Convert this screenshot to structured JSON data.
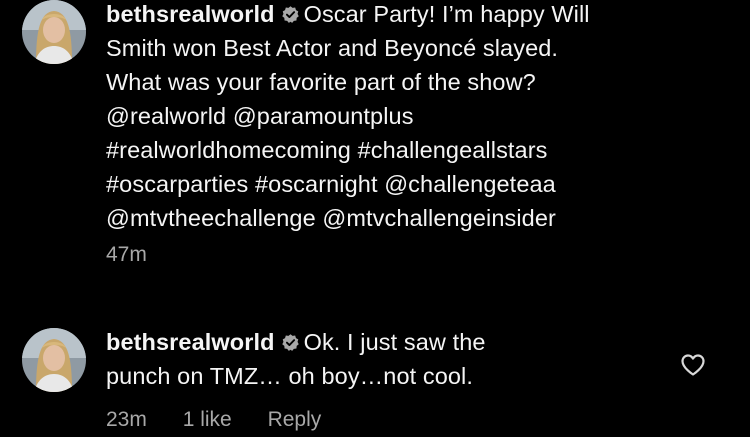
{
  "caption": {
    "username": "bethsrealworld",
    "verified_icon": "verified-badge-icon",
    "lines": [
      "Oscar Party! I’m happy Will",
      "Smith won Best Actor and Beyoncé slayed.",
      "What was your favorite part of the show?",
      "@realworld @paramountplus",
      "#realworldhomecoming #challengeallstars",
      "#oscarparties #oscarnight @challengeteaa",
      "@mtvtheechallenge @mtvchallengeinsider"
    ],
    "time": "47m"
  },
  "comment": {
    "username": "bethsrealworld",
    "verified_icon": "verified-badge-icon",
    "lines": [
      "Ok. I just saw the",
      "punch on TMZ… oh boy…not cool."
    ],
    "time": "23m",
    "likes": "1 like",
    "reply_label": "Reply",
    "like_icon": "heart-outline-icon"
  },
  "colors": {
    "background": "#000000",
    "text": "#f5f5f5",
    "secondary_text": "#a8a8a8"
  }
}
